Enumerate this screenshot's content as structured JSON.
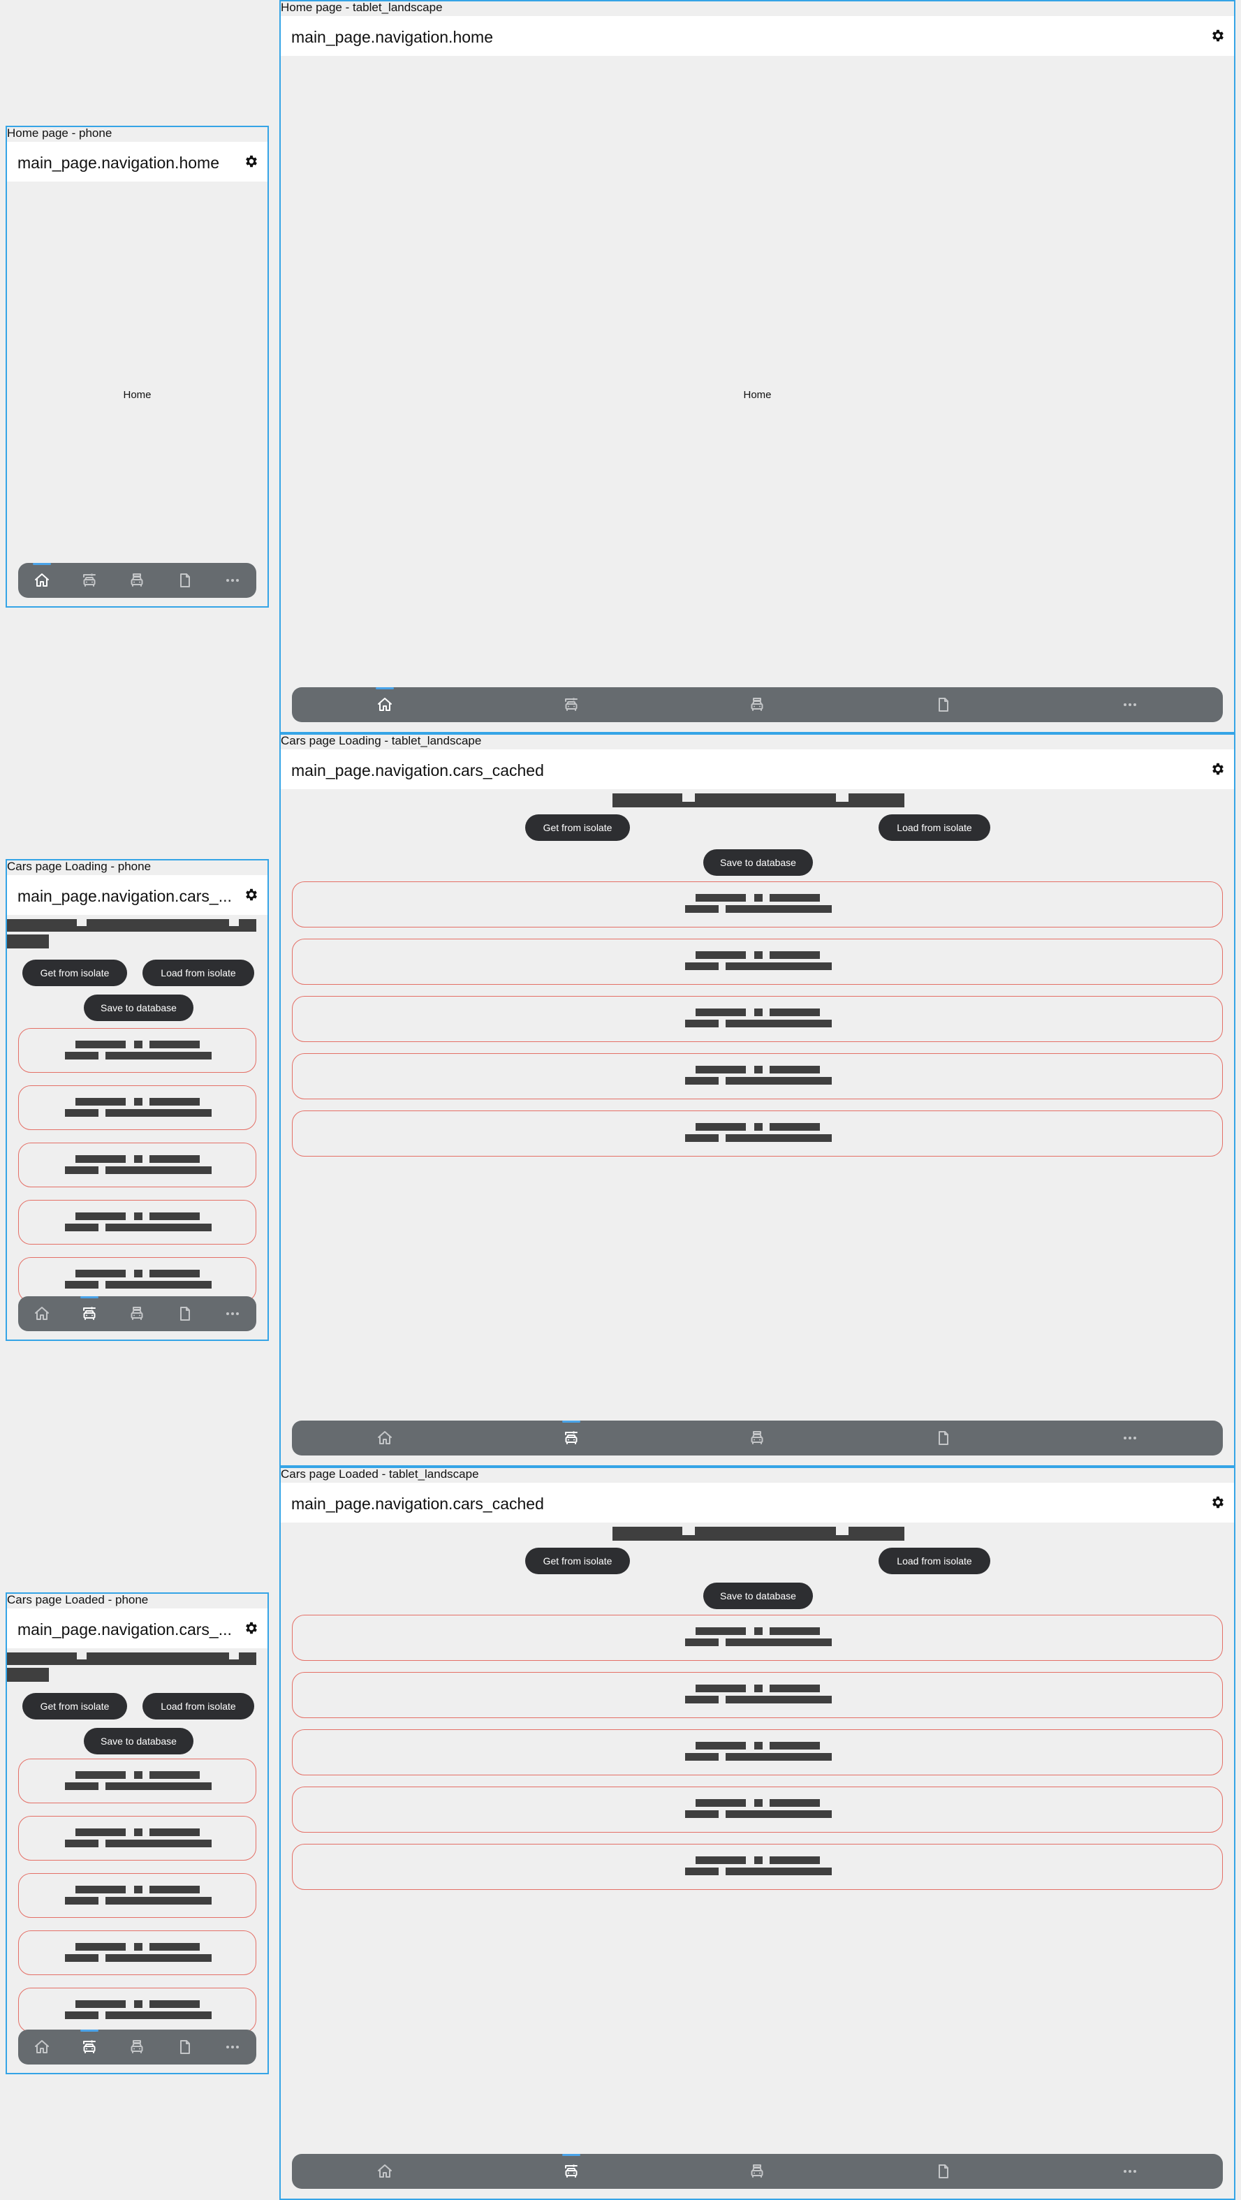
{
  "frames": {
    "home_phone": "Home page - phone",
    "home_tablet": "Home page - tablet_landscape",
    "cars_loading_phone": "Cars page Loading - phone",
    "cars_loading_tablet": "Cars page Loading - tablet_landscape",
    "cars_loaded_phone": "Cars page Loaded - phone",
    "cars_loaded_tablet": "Cars page Loaded - tablet_landscape"
  },
  "appbar": {
    "home_title": "main_page.navigation.home",
    "cars_title": "main_page.navigation.cars_cached",
    "cars_title_phone": "main_page.navigation.cars_..."
  },
  "home": {
    "body_text": "Home"
  },
  "cars": {
    "get_isolate_label": "Get from isolate",
    "load_isolate_label": "Load from isolate",
    "save_database_label": "Save to database",
    "card_count": 5
  },
  "bottom_nav": {
    "items": [
      {
        "icon": "home-icon"
      },
      {
        "icon": "car-cached-icon"
      },
      {
        "icon": "car-isolate-icon"
      },
      {
        "icon": "document-icon"
      },
      {
        "icon": "more-icon"
      }
    ],
    "active_home": 0,
    "active_cars": 1
  },
  "colors": {
    "frame_border": "#35a4e6",
    "nav_background": "#666b6f",
    "nav_indicator": "#4aa3e8",
    "button_background": "#2d2e31",
    "card_border": "#e46f66",
    "redacted": "#3f3f3f"
  }
}
